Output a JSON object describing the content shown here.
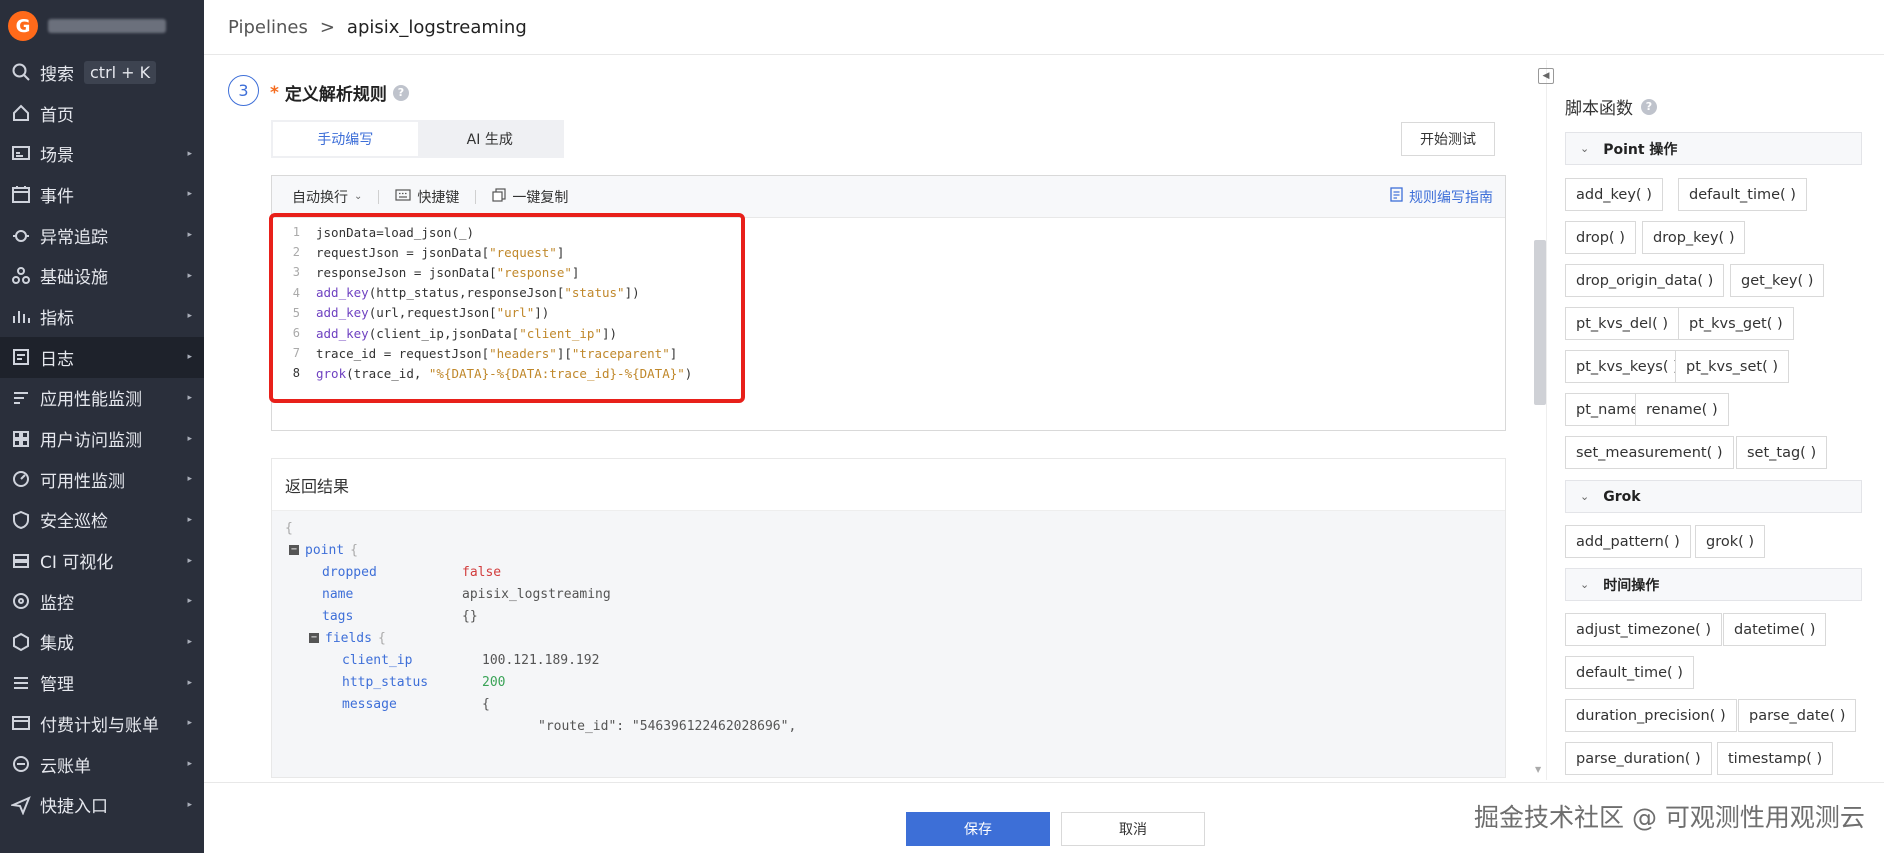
{
  "breadcrumb": {
    "root": "Pipelines",
    "separator": ">",
    "current": "apisix_logstreaming"
  },
  "sidebar": {
    "search": {
      "label": "搜索",
      "shortcut": "ctrl + K"
    },
    "items": [
      {
        "label": "首页",
        "icon": "home-icon"
      },
      {
        "label": "场景",
        "icon": "dashboard-icon"
      },
      {
        "label": "事件",
        "icon": "calendar-icon"
      },
      {
        "label": "异常追踪",
        "icon": "bug-icon"
      },
      {
        "label": "基础设施",
        "icon": "cluster-icon"
      },
      {
        "label": "指标",
        "icon": "chart-icon"
      },
      {
        "label": "日志",
        "icon": "log-icon"
      },
      {
        "label": "应用性能监测",
        "icon": "apm-icon"
      },
      {
        "label": "用户访问监测",
        "icon": "rum-icon"
      },
      {
        "label": "可用性监测",
        "icon": "dial-icon"
      },
      {
        "label": "安全巡检",
        "icon": "shield-icon"
      },
      {
        "label": "CI 可视化",
        "icon": "ci-icon"
      },
      {
        "label": "监控",
        "icon": "monitor-icon"
      },
      {
        "label": "集成",
        "icon": "integration-icon"
      },
      {
        "label": "管理",
        "icon": "sliders-icon"
      },
      {
        "label": "付费计划与账单",
        "icon": "billing-icon"
      },
      {
        "label": "云账单",
        "icon": "cloud-icon"
      },
      {
        "label": "快捷入口",
        "icon": "send-icon"
      }
    ]
  },
  "step": {
    "number": "3",
    "required_mark": "*",
    "title": "定义解析规则",
    "help": "?"
  },
  "tabs": [
    {
      "label": "手动编写"
    },
    {
      "label": "AI 生成"
    }
  ],
  "test_button": "开始测试",
  "editor": {
    "toolbar": {
      "wrap": "自动换行",
      "shortcuts": "快捷键",
      "copy": "一键复制",
      "guide": "规则编写指南"
    },
    "lines": [
      {
        "n": "1",
        "text": "jsonData=load_json(_)"
      },
      {
        "n": "2",
        "text": "requestJson = jsonData[\"request\"]"
      },
      {
        "n": "3",
        "text": "responseJson = jsonData[\"response\"]"
      },
      {
        "n": "4",
        "text": "add_key(http_status,responseJson[\"status\"])"
      },
      {
        "n": "5",
        "text": "add_key(url,requestJson[\"url\"])"
      },
      {
        "n": "6",
        "text": "add_key(client_ip,jsonData[\"client_ip\"])"
      },
      {
        "n": "7",
        "text": "trace_id = requestJson[\"headers\"][\"traceparent\"]"
      },
      {
        "n": "8",
        "text": "grok(trace_id, \"%{DATA}-%{DATA:trace_id}-%{DATA}\")"
      }
    ]
  },
  "result": {
    "title": "返回结果",
    "open_brace": "{",
    "point_key": "point",
    "dropped_key": "dropped",
    "dropped_val": "false",
    "name_key": "name",
    "name_val": "apisix_logstreaming",
    "tags_key": "tags",
    "tags_val": "{}",
    "fields_key": "fields",
    "client_ip_key": "client_ip",
    "client_ip_val": "100.121.189.192",
    "http_status_key": "http_status",
    "http_status_val": "200",
    "message_key": "message",
    "message_val": "{",
    "route_line": "\"route_id\": \"546396122462028696\","
  },
  "right_panel": {
    "title": "脚本函数",
    "groups": [
      {
        "name": "Point 操作",
        "fns": [
          "add_key( )",
          "default_time( )",
          "drop( )",
          "drop_key( )",
          "drop_origin_data( )",
          "get_key( )",
          "pt_kvs_del( )",
          "pt_kvs_get( )",
          "pt_kvs_keys( )",
          "pt_kvs_set( )",
          "pt_name( )",
          "rename( )",
          "set_measurement( )",
          "set_tag( )"
        ]
      },
      {
        "name": "Grok",
        "fns": [
          "add_pattern( )",
          "grok( )"
        ]
      },
      {
        "name": "时间操作",
        "fns": [
          "adjust_timezone( )",
          "datetime( )",
          "default_time( )",
          "duration_precision( )",
          "parse_date( )",
          "parse_duration( )",
          "timestamp( )"
        ]
      }
    ]
  },
  "footer": {
    "save": "保存",
    "cancel": "取消"
  },
  "watermark": "掘金技术社区 @ 可观测性用观测云",
  "colors": {
    "accent": "#3d6fd7",
    "sidebar_bg": "#2a2f3b",
    "highlight": "#e8201a",
    "logo": "#ff6a1a"
  }
}
